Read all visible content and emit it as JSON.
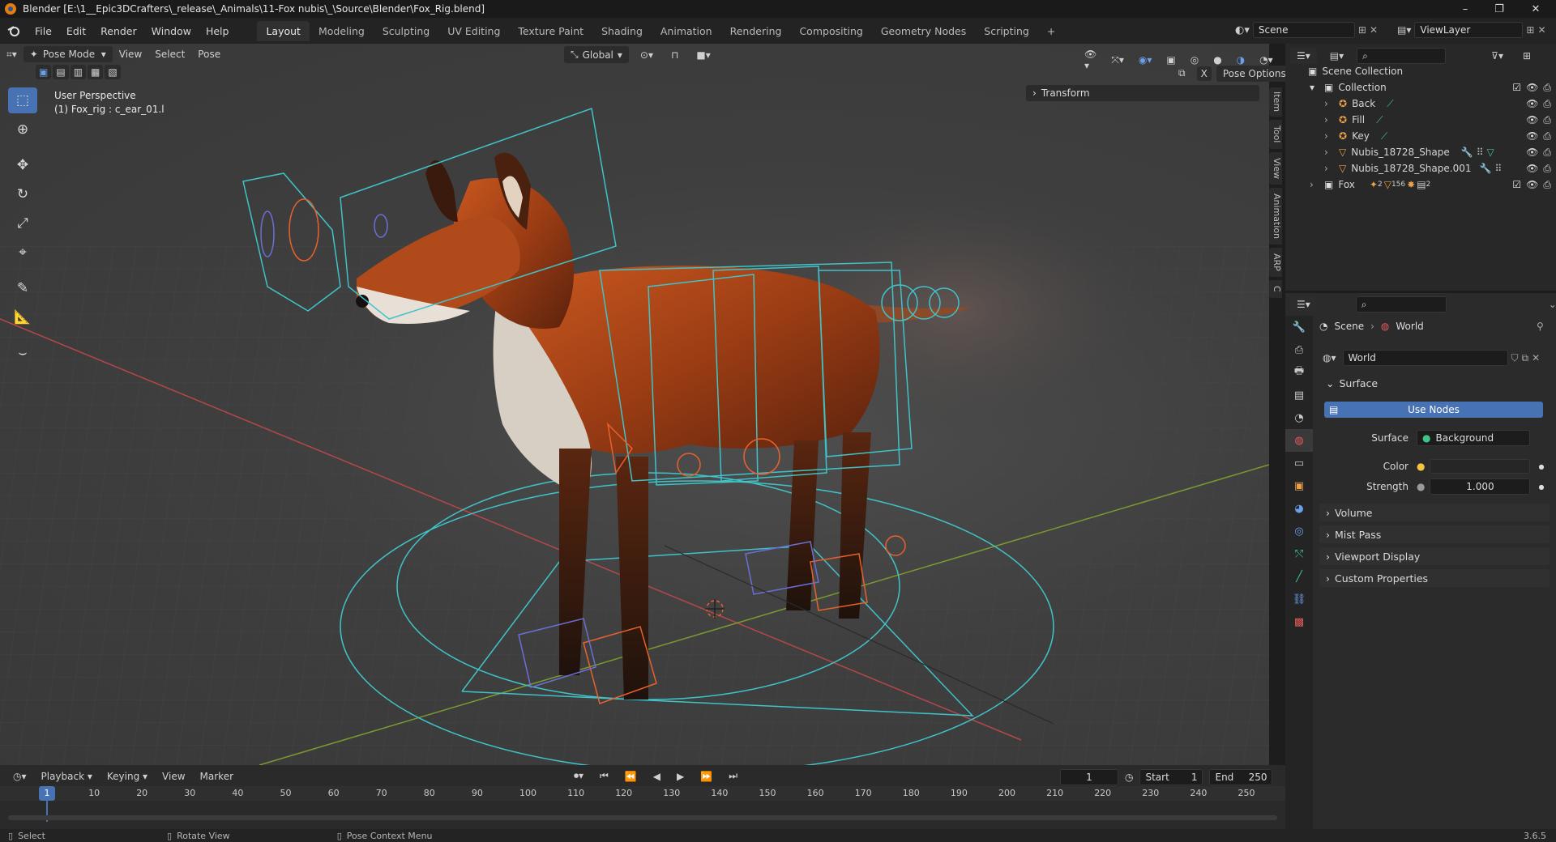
{
  "window": {
    "title": "Blender [E:\\1__Epic3DCrafters\\_release\\_Animals\\11-Fox nubis\\_\\Source\\Blender\\Fox_Rig.blend]",
    "controls": [
      "–",
      "❐",
      "✕"
    ]
  },
  "menu": {
    "items": [
      "File",
      "Edit",
      "Render",
      "Window",
      "Help"
    ]
  },
  "workspaces": {
    "tabs": [
      "Layout",
      "Modeling",
      "Sculpting",
      "UV Editing",
      "Texture Paint",
      "Shading",
      "Animation",
      "Rendering",
      "Compositing",
      "Geometry Nodes",
      "Scripting"
    ],
    "active": "Layout",
    "add": "+"
  },
  "scene_selector": {
    "value": "Scene"
  },
  "viewlayer_selector": {
    "value": "ViewLayer"
  },
  "viewport": {
    "mode": "Pose Mode",
    "menus": [
      "View",
      "Select",
      "Pose"
    ],
    "orientation": "Global",
    "perspective": "User Perspective",
    "object_info": "(1) Fox_rig : c_ear_01.l",
    "transform_panel": "Transform",
    "pose_options": "Pose Options",
    "side_tabs": [
      "Item",
      "Tool",
      "View",
      "Animation",
      "ARP",
      "C"
    ],
    "x_label": "X"
  },
  "outliner": {
    "root": "Scene Collection",
    "items": [
      {
        "name": "Collection",
        "depth": 1
      },
      {
        "name": "Back",
        "depth": 2
      },
      {
        "name": "Fill",
        "depth": 2
      },
      {
        "name": "Key",
        "depth": 2
      },
      {
        "name": "Nubis_18728_Shape",
        "depth": 2
      },
      {
        "name": "Nubis_18728_Shape.001",
        "depth": 2
      },
      {
        "name": "Fox",
        "depth": 1
      }
    ],
    "fox_badges": [
      "2",
      "156",
      "2"
    ]
  },
  "properties": {
    "breadcrumb": [
      "Scene",
      "World"
    ],
    "world_name": "World",
    "surface_section": "Surface",
    "use_nodes": "Use Nodes",
    "surface_label": "Surface",
    "surface_value": "Background",
    "color_label": "Color",
    "strength_label": "Strength",
    "strength_value": "1.000",
    "sections": [
      "Volume",
      "Mist Pass",
      "Viewport Display",
      "Custom Properties"
    ]
  },
  "timeline": {
    "menus": [
      "Playback",
      "Keying",
      "View",
      "Marker"
    ],
    "current_frame": "1",
    "start_label": "Start",
    "start_value": "1",
    "end_label": "End",
    "end_value": "250",
    "ruler": [
      "1",
      "10",
      "20",
      "30",
      "40",
      "50",
      "60",
      "70",
      "80",
      "90",
      "100",
      "110",
      "120",
      "130",
      "140",
      "150",
      "160",
      "170",
      "180",
      "190",
      "200",
      "210",
      "220",
      "230",
      "240",
      "250"
    ]
  },
  "statusbar": {
    "hints": [
      "Select",
      "Rotate View",
      "Pose Context Menu"
    ],
    "version": "3.6.5"
  },
  "colors": {
    "accent": "#4772b3",
    "rig_cyan": "#3fc3c9",
    "rig_orange": "#e8612c",
    "rig_blue": "#6a6fd6",
    "world_color": "#f5c542"
  }
}
